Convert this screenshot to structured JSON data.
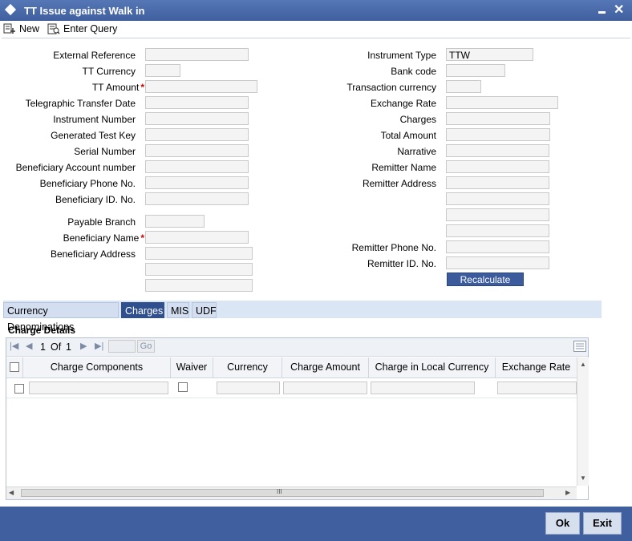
{
  "window": {
    "title": "TT Issue against Walk in"
  },
  "toolbar": {
    "new_label": "New",
    "enter_query_label": "Enter Query"
  },
  "left_fields": {
    "external_reference": "External Reference",
    "tt_currency": "TT Currency",
    "tt_amount": "TT Amount",
    "telegraphic_transfer_date": "Telegraphic Transfer Date",
    "instrument_number": "Instrument Number",
    "generated_test_key": "Generated Test Key",
    "serial_number": "Serial Number",
    "beneficiary_account_number": "Beneficiary Account number",
    "beneficiary_phone_no": "Beneficiary Phone No.",
    "beneficiary_id_no": "Beneficiary ID. No.",
    "payable_branch": "Payable Branch",
    "beneficiary_name": "Beneficiary Name",
    "beneficiary_address": "Beneficiary Address",
    "required_mark": "*"
  },
  "right_fields": {
    "instrument_type": "Instrument Type",
    "instrument_type_value": "TTW",
    "bank_code": "Bank code",
    "transaction_currency": "Transaction currency",
    "exchange_rate": "Exchange Rate",
    "charges": "Charges",
    "total_amount": "Total Amount",
    "narrative": "Narrative",
    "remitter_name": "Remitter Name",
    "remitter_address": "Remitter Address",
    "remitter_phone_no": "Remitter Phone No.",
    "remitter_id_no": "Remitter ID. No.",
    "recalculate_label": "Recalculate"
  },
  "tabs": [
    "Currency Denominations",
    "Charges",
    "MIS",
    "UDF"
  ],
  "charge_details": {
    "title": "Charge Details",
    "pager": {
      "current": "1",
      "of_label": "Of",
      "total": "1",
      "go_label": "Go"
    },
    "columns": [
      "Charge Components",
      "Waiver",
      "Currency",
      "Charge Amount",
      "Charge in Local Currency",
      "Exchange Rate"
    ],
    "scroll_grip": "III"
  },
  "footer": {
    "ok_label": "Ok",
    "exit_label": "Exit"
  },
  "colors": {
    "title_bar": "#3f5f9f",
    "active_tab": "#2f4f8f",
    "required": "#cc0000"
  }
}
